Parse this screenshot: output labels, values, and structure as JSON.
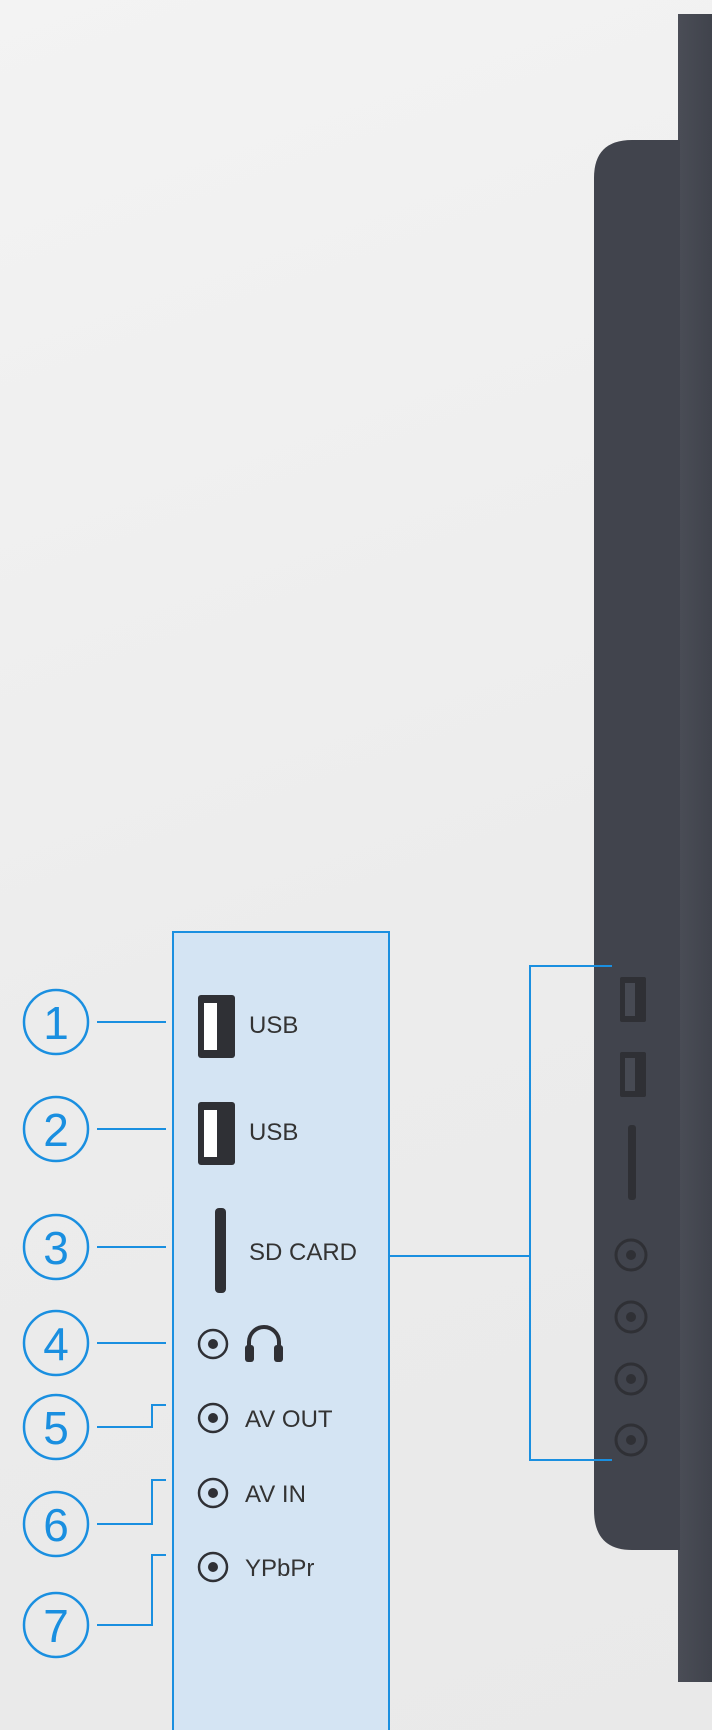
{
  "diagram": {
    "title": "",
    "colors": {
      "accent": "#1a8fe0",
      "panel_fill": "#d4e4f3",
      "device_dark": "#474a53",
      "device_body": "#3f424b",
      "port_dark": "#2f3035",
      "background": "#ececec"
    },
    "ports": [
      {
        "number": "1",
        "label": "USB",
        "icon": "usb-port-icon"
      },
      {
        "number": "2",
        "label": "USB",
        "icon": "usb-port-icon"
      },
      {
        "number": "3",
        "label": "SD CARD",
        "icon": "sd-card-slot-icon"
      },
      {
        "number": "4",
        "label": "",
        "icon": "headphone-icon"
      },
      {
        "number": "5",
        "label": "AV OUT",
        "icon": "audio-jack-icon"
      },
      {
        "number": "6",
        "label": "AV IN",
        "icon": "audio-jack-icon"
      },
      {
        "number": "7",
        "label": "YPbPr",
        "icon": "audio-jack-icon"
      }
    ]
  }
}
